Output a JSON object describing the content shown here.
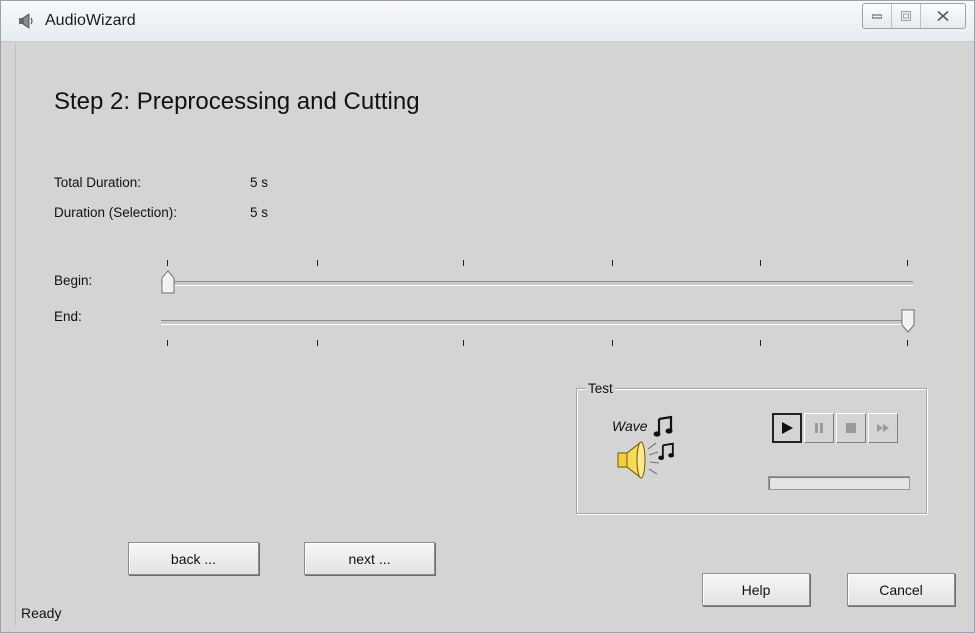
{
  "window": {
    "title": "AudioWizard",
    "icon": "speaker-icon",
    "controls": [
      "minimize-icon",
      "maximize-icon",
      "close-icon"
    ]
  },
  "page": {
    "heading": "Step 2: Preprocessing and Cutting"
  },
  "info": {
    "total_duration_label": "Total Duration:",
    "total_duration_value": "5 s",
    "selection_duration_label": "Duration (Selection):",
    "selection_duration_value": "5 s"
  },
  "sliders": {
    "begin_label": "Begin:",
    "begin_value": 0,
    "end_label": "End:",
    "end_value": 1
  },
  "test": {
    "group_label": "Test",
    "wave_label": "Wave",
    "buttons": [
      "play-icon",
      "pause-icon",
      "stop-icon",
      "fast-forward-icon"
    ],
    "progress": 0
  },
  "nav": {
    "back_label": "back ...",
    "next_label": "next ...",
    "help_label": "Help",
    "cancel_label": "Cancel"
  },
  "status": {
    "text": "Ready"
  },
  "colors": {
    "dialog_bg": "#d4d4d4",
    "titlebar_bg": "#eef1f4",
    "speaker_yellow": "#f2cf38"
  }
}
